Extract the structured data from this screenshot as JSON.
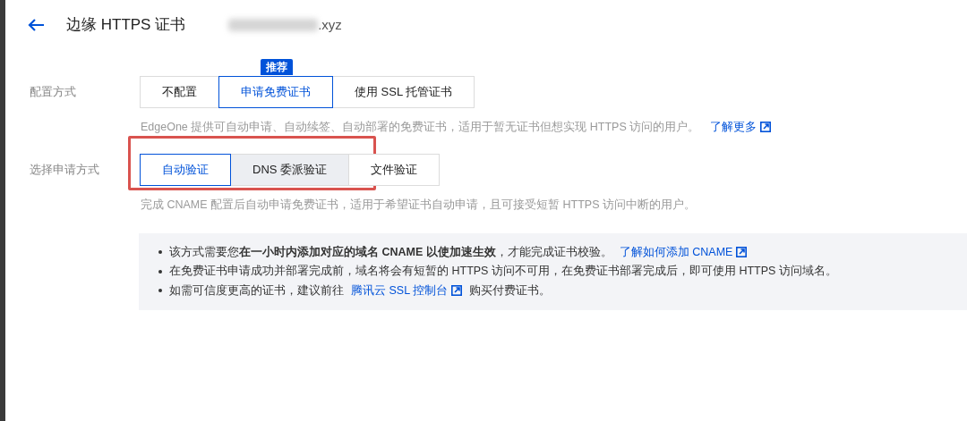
{
  "header": {
    "title": "边缘 HTTPS 证书",
    "domain": ".xyz"
  },
  "fields": [
    {
      "label": "配置方式",
      "annotated": false,
      "options": [
        {
          "label": "不配置",
          "selected": false,
          "hovered": false
        },
        {
          "label": "申请免费证书",
          "selected": true,
          "hovered": false,
          "badge": "推荐"
        },
        {
          "label": "使用 SSL 托管证书",
          "selected": false,
          "hovered": false
        }
      ],
      "description": "EdgeOne 提供可自动申请、自动续签、自动部署的免费证书，适用于暂无证书但想实现 HTTPS 访问的用户。",
      "link": "了解更多"
    },
    {
      "label": "选择申请方式",
      "annotated": true,
      "options": [
        {
          "label": "自动验证",
          "selected": true,
          "hovered": false
        },
        {
          "label": "DNS 委派验证",
          "selected": false,
          "hovered": true
        },
        {
          "label": "文件验证",
          "selected": false,
          "hovered": false
        }
      ],
      "description": "完成 CNAME 配置后自动申请免费证书，适用于希望证书自动申请，且可接受短暂 HTTPS 访问中断的用户。"
    }
  ],
  "notes": [
    {
      "text": "该方式需要您**在一小时内添加对应的域名 CNAME 以使加速生效**，才能完成证书校验。",
      "link": "了解如何添加 CNAME"
    },
    {
      "text": "在免费证书申请成功并部署完成前，域名将会有短暂的 HTTPS 访问不可用，在免费证书部署完成后，即可使用 HTTPS 访问域名。"
    },
    {
      "text": "如需可信度更高的证书，建议前往",
      "link": "腾讯云 SSL 控制台",
      "after": "购买付费证书。"
    }
  ]
}
